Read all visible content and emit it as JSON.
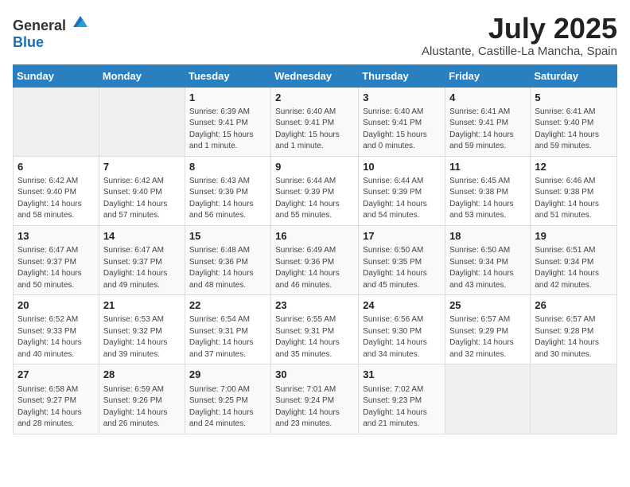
{
  "logo": {
    "text_general": "General",
    "text_blue": "Blue"
  },
  "title": {
    "month": "July 2025",
    "location": "Alustante, Castille-La Mancha, Spain"
  },
  "weekdays": [
    "Sunday",
    "Monday",
    "Tuesday",
    "Wednesday",
    "Thursday",
    "Friday",
    "Saturday"
  ],
  "weeks": [
    [
      {
        "day": "",
        "info": ""
      },
      {
        "day": "",
        "info": ""
      },
      {
        "day": "1",
        "info": "Sunrise: 6:39 AM\nSunset: 9:41 PM\nDaylight: 15 hours and 1 minute."
      },
      {
        "day": "2",
        "info": "Sunrise: 6:40 AM\nSunset: 9:41 PM\nDaylight: 15 hours and 1 minute."
      },
      {
        "day": "3",
        "info": "Sunrise: 6:40 AM\nSunset: 9:41 PM\nDaylight: 15 hours and 0 minutes."
      },
      {
        "day": "4",
        "info": "Sunrise: 6:41 AM\nSunset: 9:41 PM\nDaylight: 14 hours and 59 minutes."
      },
      {
        "day": "5",
        "info": "Sunrise: 6:41 AM\nSunset: 9:40 PM\nDaylight: 14 hours and 59 minutes."
      }
    ],
    [
      {
        "day": "6",
        "info": "Sunrise: 6:42 AM\nSunset: 9:40 PM\nDaylight: 14 hours and 58 minutes."
      },
      {
        "day": "7",
        "info": "Sunrise: 6:42 AM\nSunset: 9:40 PM\nDaylight: 14 hours and 57 minutes."
      },
      {
        "day": "8",
        "info": "Sunrise: 6:43 AM\nSunset: 9:39 PM\nDaylight: 14 hours and 56 minutes."
      },
      {
        "day": "9",
        "info": "Sunrise: 6:44 AM\nSunset: 9:39 PM\nDaylight: 14 hours and 55 minutes."
      },
      {
        "day": "10",
        "info": "Sunrise: 6:44 AM\nSunset: 9:39 PM\nDaylight: 14 hours and 54 minutes."
      },
      {
        "day": "11",
        "info": "Sunrise: 6:45 AM\nSunset: 9:38 PM\nDaylight: 14 hours and 53 minutes."
      },
      {
        "day": "12",
        "info": "Sunrise: 6:46 AM\nSunset: 9:38 PM\nDaylight: 14 hours and 51 minutes."
      }
    ],
    [
      {
        "day": "13",
        "info": "Sunrise: 6:47 AM\nSunset: 9:37 PM\nDaylight: 14 hours and 50 minutes."
      },
      {
        "day": "14",
        "info": "Sunrise: 6:47 AM\nSunset: 9:37 PM\nDaylight: 14 hours and 49 minutes."
      },
      {
        "day": "15",
        "info": "Sunrise: 6:48 AM\nSunset: 9:36 PM\nDaylight: 14 hours and 48 minutes."
      },
      {
        "day": "16",
        "info": "Sunrise: 6:49 AM\nSunset: 9:36 PM\nDaylight: 14 hours and 46 minutes."
      },
      {
        "day": "17",
        "info": "Sunrise: 6:50 AM\nSunset: 9:35 PM\nDaylight: 14 hours and 45 minutes."
      },
      {
        "day": "18",
        "info": "Sunrise: 6:50 AM\nSunset: 9:34 PM\nDaylight: 14 hours and 43 minutes."
      },
      {
        "day": "19",
        "info": "Sunrise: 6:51 AM\nSunset: 9:34 PM\nDaylight: 14 hours and 42 minutes."
      }
    ],
    [
      {
        "day": "20",
        "info": "Sunrise: 6:52 AM\nSunset: 9:33 PM\nDaylight: 14 hours and 40 minutes."
      },
      {
        "day": "21",
        "info": "Sunrise: 6:53 AM\nSunset: 9:32 PM\nDaylight: 14 hours and 39 minutes."
      },
      {
        "day": "22",
        "info": "Sunrise: 6:54 AM\nSunset: 9:31 PM\nDaylight: 14 hours and 37 minutes."
      },
      {
        "day": "23",
        "info": "Sunrise: 6:55 AM\nSunset: 9:31 PM\nDaylight: 14 hours and 35 minutes."
      },
      {
        "day": "24",
        "info": "Sunrise: 6:56 AM\nSunset: 9:30 PM\nDaylight: 14 hours and 34 minutes."
      },
      {
        "day": "25",
        "info": "Sunrise: 6:57 AM\nSunset: 9:29 PM\nDaylight: 14 hours and 32 minutes."
      },
      {
        "day": "26",
        "info": "Sunrise: 6:57 AM\nSunset: 9:28 PM\nDaylight: 14 hours and 30 minutes."
      }
    ],
    [
      {
        "day": "27",
        "info": "Sunrise: 6:58 AM\nSunset: 9:27 PM\nDaylight: 14 hours and 28 minutes."
      },
      {
        "day": "28",
        "info": "Sunrise: 6:59 AM\nSunset: 9:26 PM\nDaylight: 14 hours and 26 minutes."
      },
      {
        "day": "29",
        "info": "Sunrise: 7:00 AM\nSunset: 9:25 PM\nDaylight: 14 hours and 24 minutes."
      },
      {
        "day": "30",
        "info": "Sunrise: 7:01 AM\nSunset: 9:24 PM\nDaylight: 14 hours and 23 minutes."
      },
      {
        "day": "31",
        "info": "Sunrise: 7:02 AM\nSunset: 9:23 PM\nDaylight: 14 hours and 21 minutes."
      },
      {
        "day": "",
        "info": ""
      },
      {
        "day": "",
        "info": ""
      }
    ]
  ]
}
